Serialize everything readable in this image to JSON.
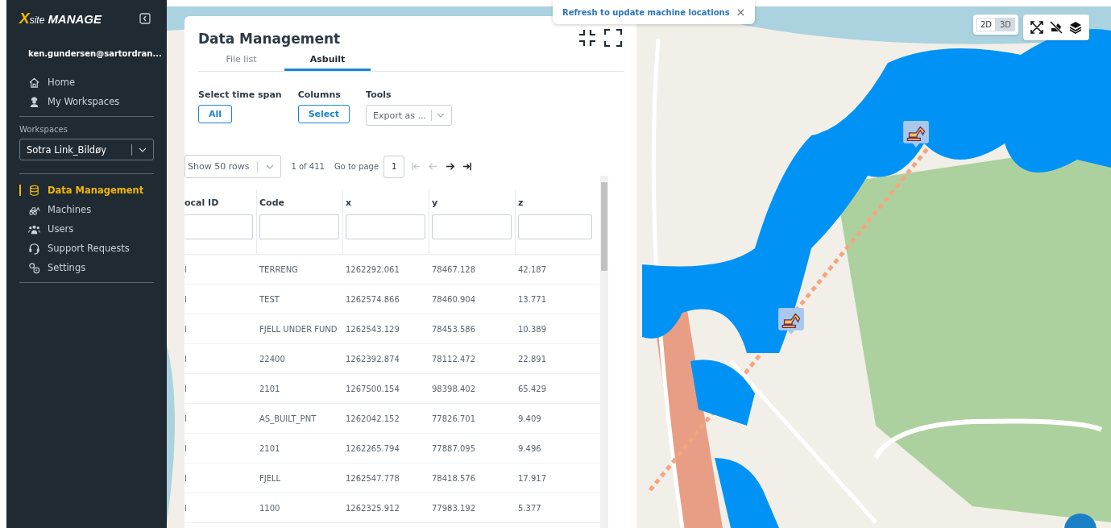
{
  "sidebar": {
    "logo": {
      "mark": "X",
      "brand": "site",
      "product": "MANAGE"
    },
    "user": "ken.gundersen@sartordran...",
    "top_items": [
      {
        "label": "Home"
      },
      {
        "label": "My Workspaces"
      }
    ],
    "workspaces_label": "Workspaces",
    "workspace": "Sotra Link_Bildøy",
    "items": [
      {
        "label": "Data Management",
        "selected": true
      },
      {
        "label": "Machines",
        "selected": false
      },
      {
        "label": "Users",
        "selected": false
      },
      {
        "label": "Support Requests",
        "selected": false
      },
      {
        "label": "Settings",
        "selected": false
      }
    ]
  },
  "panel": {
    "title": "Data Management",
    "tabs": [
      {
        "label": "File list",
        "selected": false
      },
      {
        "label": "Asbuilt",
        "selected": true
      }
    ],
    "time_span": {
      "label": "Select time span",
      "button": "All"
    },
    "columns_control": {
      "label": "Columns",
      "button": "Select"
    },
    "tools": {
      "label": "Tools",
      "value": "Export as ..."
    },
    "pagination": {
      "rows_select": "Show 50 rows",
      "page_info": "1 of 411",
      "goto_label": "Go to page",
      "page": "1",
      "first_disabled": true,
      "prev_disabled": true,
      "next_disabled": false,
      "last_disabled": false
    },
    "table": {
      "columns": [
        {
          "label": "ocal ID"
        },
        {
          "label": "Code"
        },
        {
          "label": "x"
        },
        {
          "label": "y"
        },
        {
          "label": "z"
        }
      ],
      "rows": [
        [
          "l",
          "TERRENG",
          "1262292.061",
          "78467.128",
          "42.187"
        ],
        [
          "l",
          "TEST",
          "1262574.866",
          "78460.904",
          "13.771"
        ],
        [
          "l",
          "FJELL UNDER FUND",
          "1262543.129",
          "78453.586",
          "10.389"
        ],
        [
          "l",
          "22400",
          "1262392.874",
          "78112.472",
          "22.891"
        ],
        [
          "l",
          "2101",
          "1267500.154",
          "98398.402",
          "65.429"
        ],
        [
          "l",
          "AS_BUILT_PNT",
          "1262042.152",
          "77826.701",
          "9.409"
        ],
        [
          "l",
          "2101",
          "1262265.794",
          "77887.095",
          "9.496"
        ],
        [
          "l",
          "FJELL",
          "1262547.778",
          "78418.576",
          "17.917"
        ],
        [
          "l",
          "1100",
          "1262325.912",
          "77983.192",
          "5.377"
        ]
      ]
    }
  },
  "map": {
    "notice": "Refresh to update machine locations",
    "close": "×",
    "view_modes": [
      {
        "label": "2D",
        "selected": true
      },
      {
        "label": "3D",
        "selected": false
      }
    ]
  }
}
